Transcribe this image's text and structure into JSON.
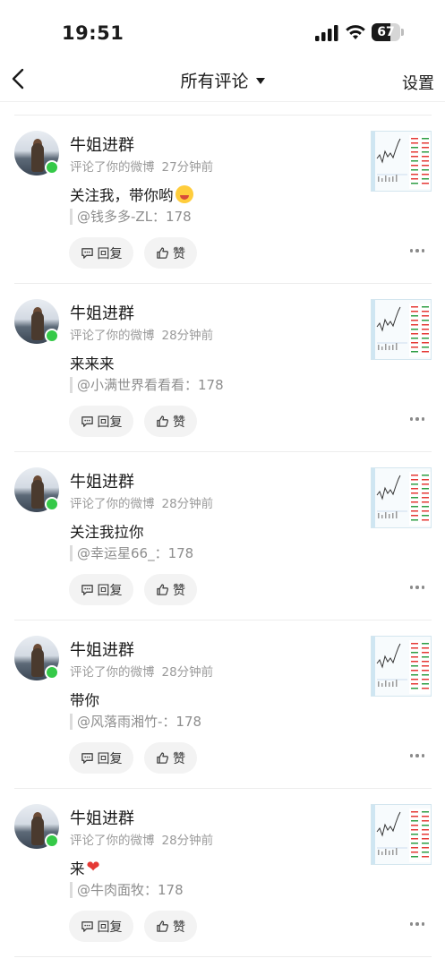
{
  "status": {
    "time": "19:51",
    "battery": "67",
    "battery_level": 0.67
  },
  "nav": {
    "title": "所有评论",
    "settings": "设置"
  },
  "items": [
    {
      "name": "牛姐进群",
      "action": "评论了你的微博",
      "time": "27分钟前",
      "content": "关注我，带你哟",
      "emoji": "scream-face",
      "quote": "@钱多多-ZL：178",
      "reply": "回复",
      "like": "赞"
    },
    {
      "name": "牛姐进群",
      "action": "评论了你的微博",
      "time": "28分钟前",
      "content": "来来来",
      "emoji": "",
      "quote": "@小满世界看看看：178",
      "reply": "回复",
      "like": "赞"
    },
    {
      "name": "牛姐进群",
      "action": "评论了你的微博",
      "time": "28分钟前",
      "content": "关注我拉你",
      "emoji": "",
      "quote": "@幸运星66_：178",
      "reply": "回复",
      "like": "赞"
    },
    {
      "name": "牛姐进群",
      "action": "评论了你的微博",
      "time": "28分钟前",
      "content": "带你",
      "emoji": "",
      "quote": "@风落雨湘竹-：178",
      "reply": "回复",
      "like": "赞"
    },
    {
      "name": "牛姐进群",
      "action": "评论了你的微博",
      "time": "28分钟前",
      "content": "来",
      "emoji": "red-heart",
      "quote": "@牛肉面牧：178",
      "reply": "回复",
      "like": "赞"
    }
  ],
  "colors": {
    "online": "#35c948",
    "accent_chart": "#e53935"
  }
}
